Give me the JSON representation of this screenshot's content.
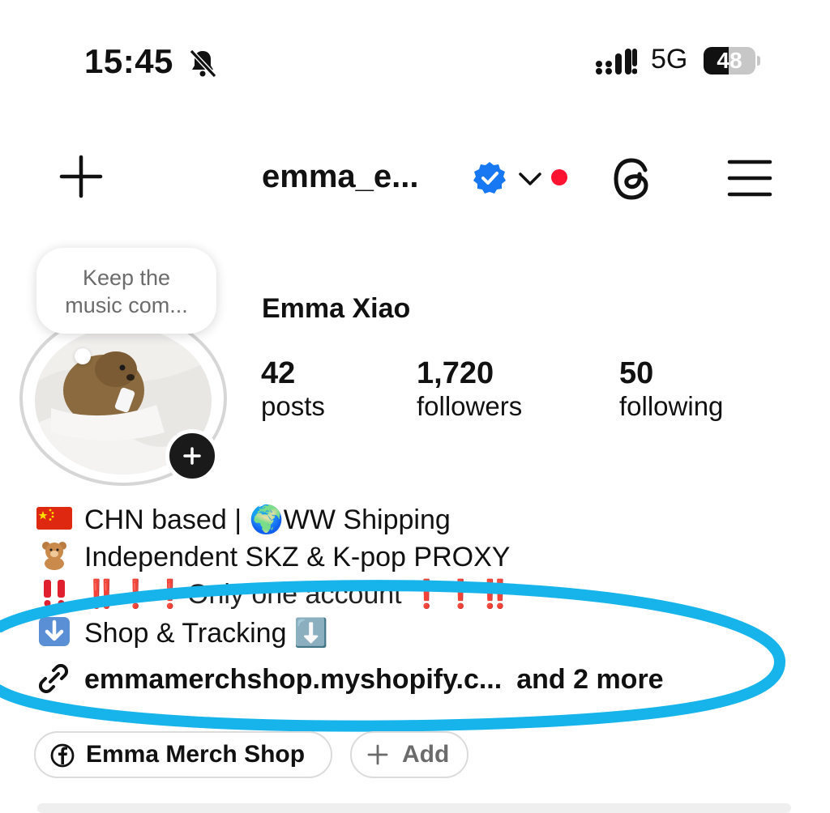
{
  "status_bar": {
    "time": "15:45",
    "network": "5G",
    "battery": "48",
    "battery_level": 0.48
  },
  "header": {
    "username": "emma_e...",
    "icons": [
      "plus-icon",
      "verified-badge-icon",
      "chevron-down-icon",
      "threads-icon",
      "menu-icon"
    ]
  },
  "profile": {
    "note": {
      "line1": "Keep the",
      "line2": "music com..."
    },
    "full_name": "Emma Xiao",
    "stats": [
      {
        "value": "42",
        "label": "posts"
      },
      {
        "value": "1,720",
        "label": "followers"
      },
      {
        "value": "50",
        "label": "following"
      }
    ]
  },
  "bio": {
    "lines": [
      {
        "emoji": "flag-china",
        "text": "CHN based | 🌍WW Shipping"
      },
      {
        "emoji": "teddy-bear",
        "text": "Independent SKZ & K-pop PROXY"
      },
      {
        "emoji": "double-exclamation",
        "text": "‼️❗️❗️Only one account ❗️❗️‼️"
      },
      {
        "emoji": "down-arrow",
        "text": "Shop & Tracking ⬇️"
      }
    ],
    "link": "emmamerchshop.myshopify.c...",
    "link_more": "and 2 more"
  },
  "chips": {
    "facebook": "Emma Merch Shop",
    "add": "Add"
  },
  "colors": {
    "highlight": "#16b4ea",
    "verified": "#1877f2",
    "red_dot": "#ff1332",
    "chip_border": "#dbdbdb"
  }
}
